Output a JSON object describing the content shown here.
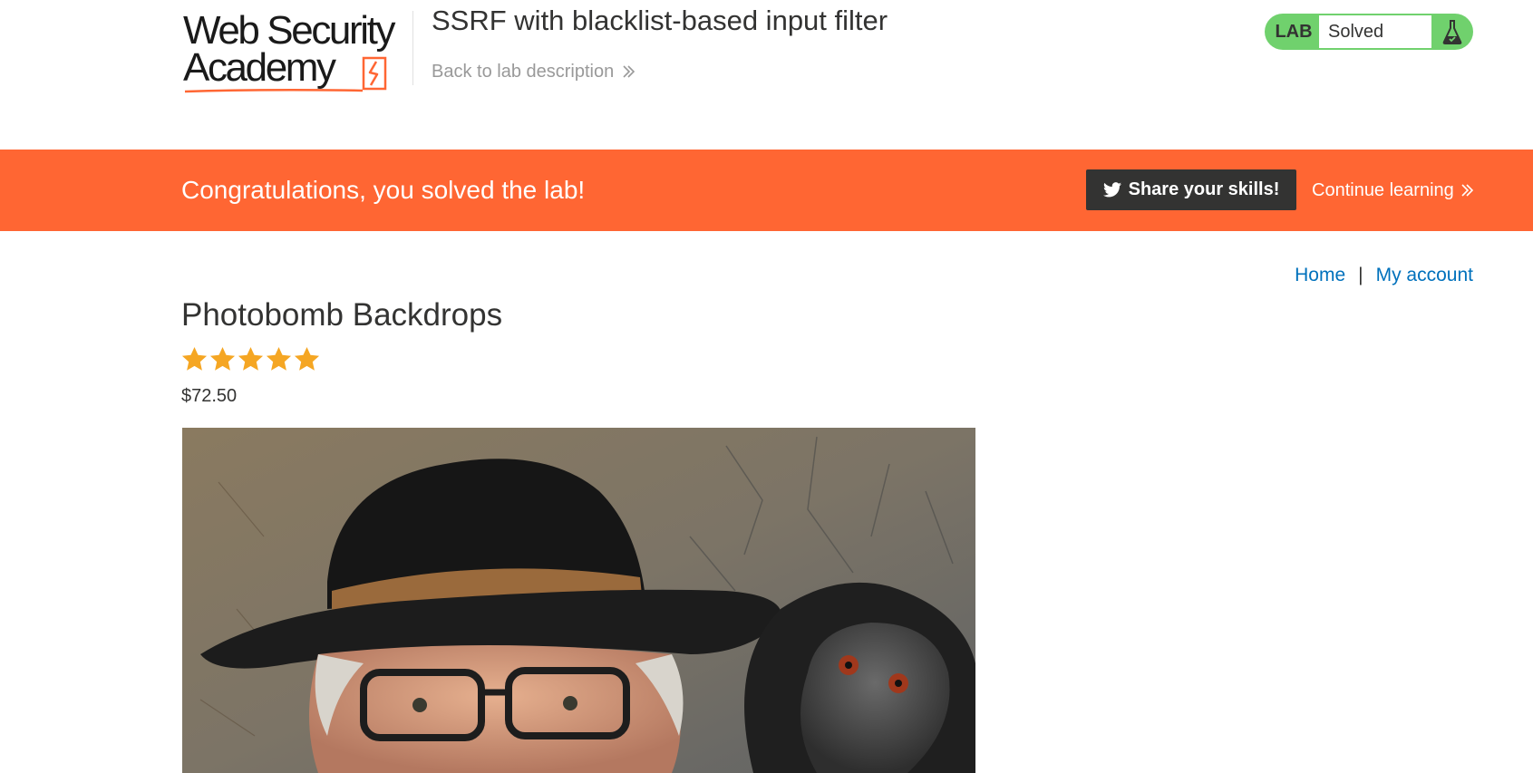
{
  "header": {
    "logo_line1": "Web Security",
    "logo_line2": "Academy",
    "lab_title": "SSRF with blacklist-based input filter",
    "back_link": "Back to lab description"
  },
  "lab_status": {
    "label": "LAB",
    "status": "Solved"
  },
  "banner": {
    "message": "Congratulations, you solved the lab!",
    "share_label": "Share your skills!",
    "continue_label": "Continue learning"
  },
  "nav": {
    "home": "Home",
    "separator": "|",
    "account": "My account"
  },
  "product": {
    "name": "Photobomb Backdrops",
    "rating": 5,
    "rating_max": 5,
    "price": "$72.50"
  },
  "colors": {
    "brand_orange": "#ff6633",
    "lab_green": "#70d16d",
    "link_blue": "#0071bc",
    "star_gold": "#f5a623",
    "dark": "#333332"
  },
  "icons": [
    "flask-icon",
    "twitter-icon",
    "chevron-double-right-icon",
    "star-icon",
    "lightning-logo-icon"
  ]
}
